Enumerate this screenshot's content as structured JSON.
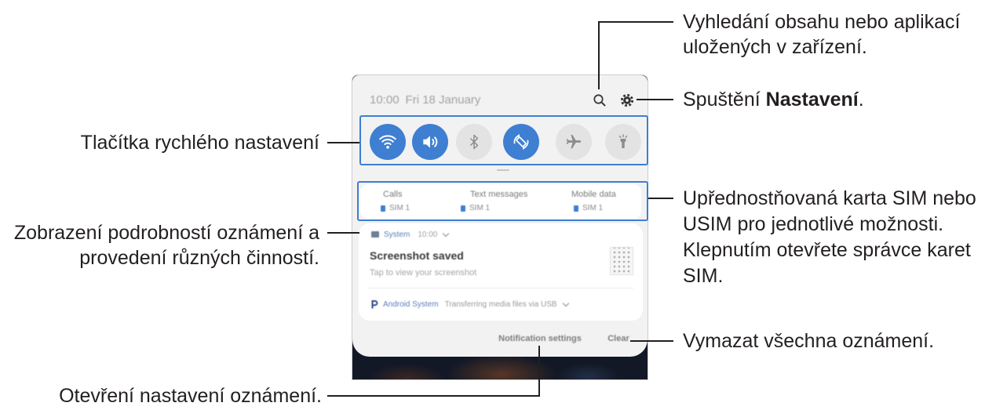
{
  "annotations": {
    "search": {
      "line1": "Vyhledání obsahu nebo aplikací",
      "line2": "uložených v zařízení."
    },
    "settings": {
      "prefix": "Spuštění ",
      "bold": "Nastavení",
      "suffix": "."
    },
    "quick_settings": "Tlačítka rychlého nastavení",
    "sim_preference": {
      "line1": "Upřednostňovaná karta SIM nebo",
      "line2": "USIM pro jednotlivé možnosti.",
      "line3": "Klepnutím otevřete správce karet",
      "line4": "SIM."
    },
    "notification_details": {
      "line1": "Zobrazení podrobností oznámení a",
      "line2": "provedení různých činností."
    },
    "clear_all": "Vymazat všechna oznámení.",
    "notification_settings": "Otevření nastavení oznámení."
  },
  "panel": {
    "status": {
      "time": "10:00",
      "date": "Fri 18 January"
    },
    "toolbar_icons": [
      "search-icon",
      "gear-icon"
    ],
    "quick_settings": [
      {
        "icon": "wifi-icon",
        "active": true
      },
      {
        "icon": "sound-icon",
        "active": true
      },
      {
        "icon": "bluetooth-icon",
        "active": false
      },
      {
        "icon": "auto-rotate-icon",
        "active": true
      },
      {
        "icon": "airplane-icon",
        "active": false
      },
      {
        "icon": "flashlight-icon",
        "active": false
      }
    ],
    "sim_preferences": [
      {
        "label": "Calls",
        "sim": "SIM 1"
      },
      {
        "label": "Text messages",
        "sim": "SIM 1"
      },
      {
        "label": "Mobile data",
        "sim": "SIM 1"
      }
    ],
    "notifications": [
      {
        "icon": "image-icon",
        "app": "System",
        "time": "10:00",
        "title": "Screenshot saved",
        "text": "Tap to view your screenshot"
      },
      {
        "icon": "android-system-icon",
        "app": "Android System",
        "text": "Transferring media files via USB"
      }
    ],
    "footer": {
      "settings": "Notification settings",
      "clear": "Clear"
    }
  },
  "colors": {
    "accent": "#3e7fd2",
    "inactive": "#e3e3e3",
    "highlight": "#3d7fd1",
    "callout_line": "#231f20"
  }
}
